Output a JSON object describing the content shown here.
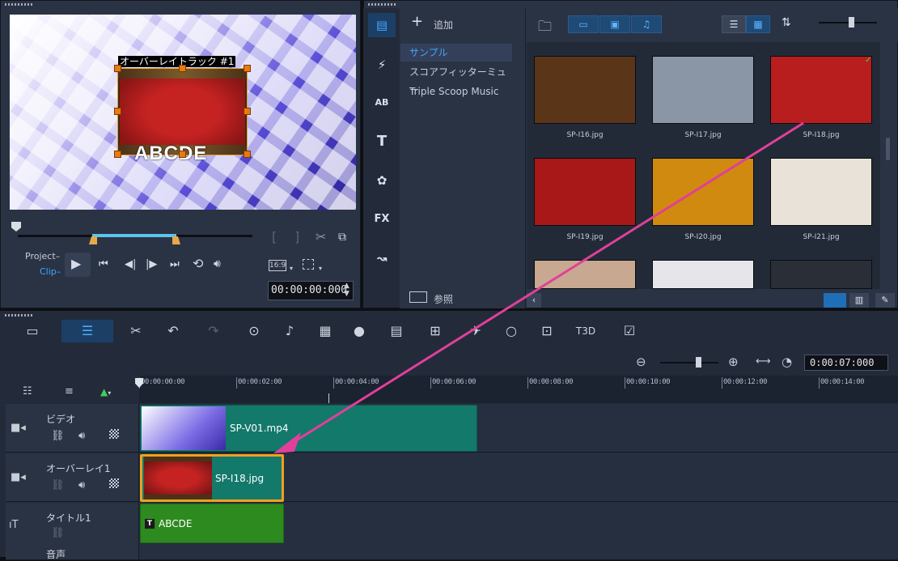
{
  "preview": {
    "overlay_label": "オーバーレイトラック #1",
    "title_text": "ABCDE",
    "project_label": "Project",
    "clip_label": "Clip",
    "aspect": "16:9",
    "timecode": "00:00:00:000"
  },
  "library": {
    "add_label": "追加",
    "folders": [
      "サンプル",
      "スコアフィッターミュー",
      "Triple Scoop Music"
    ],
    "browse_label": "参照",
    "tools": [
      "media",
      "instant-project",
      "transition",
      "title",
      "graphic",
      "filter",
      "path"
    ],
    "tool_glyphs": {
      "transition": "AB",
      "title": "T",
      "filter": "FX"
    },
    "thumbs": [
      {
        "name": "SP-I16.jpg",
        "color": "#5a3518"
      },
      {
        "name": "SP-I17.jpg",
        "color": "#8a96a6"
      },
      {
        "name": "SP-I18.jpg",
        "color": "#b81e1e"
      },
      {
        "name": "SP-I19.jpg",
        "color": "#a81818"
      },
      {
        "name": "SP-I20.jpg",
        "color": "#d08a10"
      },
      {
        "name": "SP-I21.jpg",
        "color": "#e8e2d8"
      },
      {
        "name": "",
        "color": "#c8a890"
      },
      {
        "name": "",
        "color": "#e6e6ea"
      },
      {
        "name": "",
        "color": "#2a2e36"
      }
    ]
  },
  "timeline": {
    "timecode": "0:00:07:000",
    "ruler": [
      "00:00:00:00",
      "00:00:02:00",
      "00:00:04:00",
      "00:00:06:00",
      "00:00:08:00",
      "00:00:10:00",
      "00:00:12:00",
      "00:00:14:00"
    ],
    "tracks": [
      {
        "name": "ビデオ",
        "clip": "SP-V01.mp4"
      },
      {
        "name": "オーバーレイ1",
        "clip": "SP-I18.jpg"
      },
      {
        "name": "タイトル1",
        "clip": "ABCDE"
      },
      {
        "name": "音声",
        "clip": ""
      }
    ]
  },
  "colors": {
    "accent": "#1f6fb8",
    "video_clip": "#13796a",
    "title_clip": "#2d8a1f",
    "arrow": "#e0409a"
  }
}
